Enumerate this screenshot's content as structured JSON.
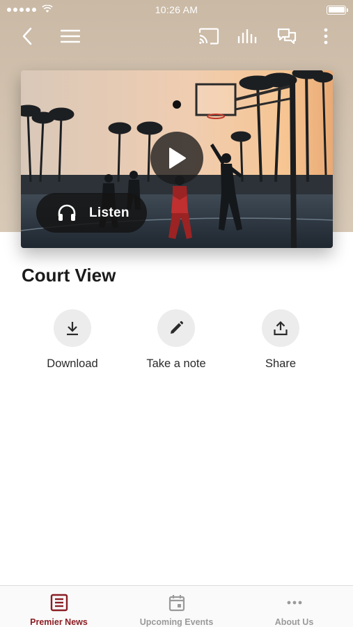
{
  "status_bar": {
    "time": "10:26 AM"
  },
  "header": {
    "back_icon": "chevron-left",
    "menu_icon": "hamburger",
    "actions": [
      "cast-icon",
      "audio-bars-icon",
      "chat-icon",
      "more-vertical-icon"
    ]
  },
  "hero": {
    "play_icon": "play",
    "listen_label": "Listen"
  },
  "article": {
    "title": "Court View"
  },
  "actions": [
    {
      "label": "Download",
      "icon": "download-icon"
    },
    {
      "label": "Take a note",
      "icon": "pencil-icon"
    },
    {
      "label": "Share",
      "icon": "share-icon"
    }
  ],
  "tabs": [
    {
      "label": "Premier News",
      "icon": "newspaper-icon",
      "active": true
    },
    {
      "label": "Upcoming Events",
      "icon": "calendar-icon",
      "active": false
    },
    {
      "label": "About Us",
      "icon": "more-horizontal-icon",
      "active": false
    }
  ],
  "colors": {
    "accent": "#8b1e24",
    "inactive_tab": "#9a9a9a",
    "header_bg": "#d1c1ae"
  }
}
